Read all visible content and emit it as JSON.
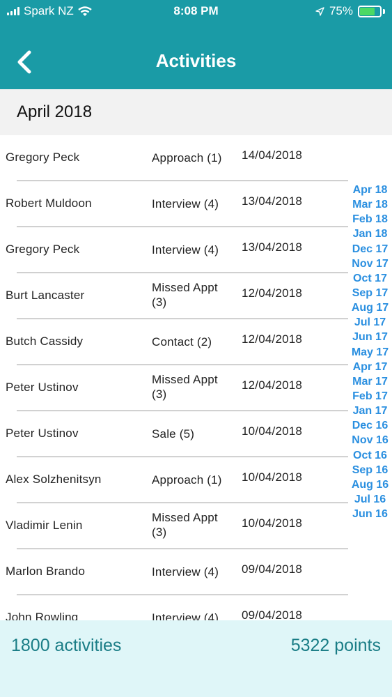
{
  "status_bar": {
    "carrier": "Spark NZ",
    "time": "8:08 PM",
    "battery": "75%"
  },
  "header": {
    "title": "Activities"
  },
  "month_header": "April 2018",
  "activities": [
    {
      "name": "Gregory Peck",
      "type": "Approach (1)",
      "date": "14/04/2018"
    },
    {
      "name": "Robert Muldoon",
      "type": "Interview (4)",
      "date": "13/04/2018"
    },
    {
      "name": "Gregory Peck",
      "type": "Interview (4)",
      "date": "13/04/2018"
    },
    {
      "name": "Burt Lancaster",
      "type": "Missed Appt (3)",
      "date": "12/04/2018"
    },
    {
      "name": "Butch Cassidy",
      "type": "Contact (2)",
      "date": "12/04/2018"
    },
    {
      "name": "Peter Ustinov",
      "type": "Missed Appt (3)",
      "date": "12/04/2018"
    },
    {
      "name": "Peter Ustinov",
      "type": "Sale (5)",
      "date": "10/04/2018"
    },
    {
      "name": "Alex Solzhenitsyn",
      "type": "Approach (1)",
      "date": "10/04/2018"
    },
    {
      "name": "Vladimir Lenin",
      "type": "Missed Appt (3)",
      "date": "10/04/2018"
    },
    {
      "name": "Marlon Brando",
      "type": "Interview (4)",
      "date": "09/04/2018"
    },
    {
      "name": "John Rowling",
      "type": "Interview (4)",
      "date": "09/04/2018"
    }
  ],
  "month_index": [
    "Apr 18",
    "Mar 18",
    "Feb 18",
    "Jan 18",
    "Dec 17",
    "Nov 17",
    "Oct 17",
    "Sep 17",
    "Aug 17",
    "Jul 17",
    "Jun 17",
    "May 17",
    "Apr 17",
    "Mar 17",
    "Feb 17",
    "Jan 17",
    "Dec 16",
    "Nov 16",
    "Oct 16",
    "Sep 16",
    "Aug 16",
    "Jul 16",
    "Jun 16"
  ],
  "footer": {
    "activities_count": "1800 activities",
    "points": "5322 points"
  },
  "colors": {
    "header": "#1a9ba6",
    "index_link": "#2a8fe0",
    "footer_bg": "#dff6f8",
    "footer_text": "#1a7d86",
    "battery": "#4cd964"
  },
  "icons": {
    "back": "chevron-left-icon",
    "wifi": "wifi-icon",
    "location": "location-arrow-icon",
    "signal": "signal-bars-icon",
    "battery": "battery-icon"
  }
}
